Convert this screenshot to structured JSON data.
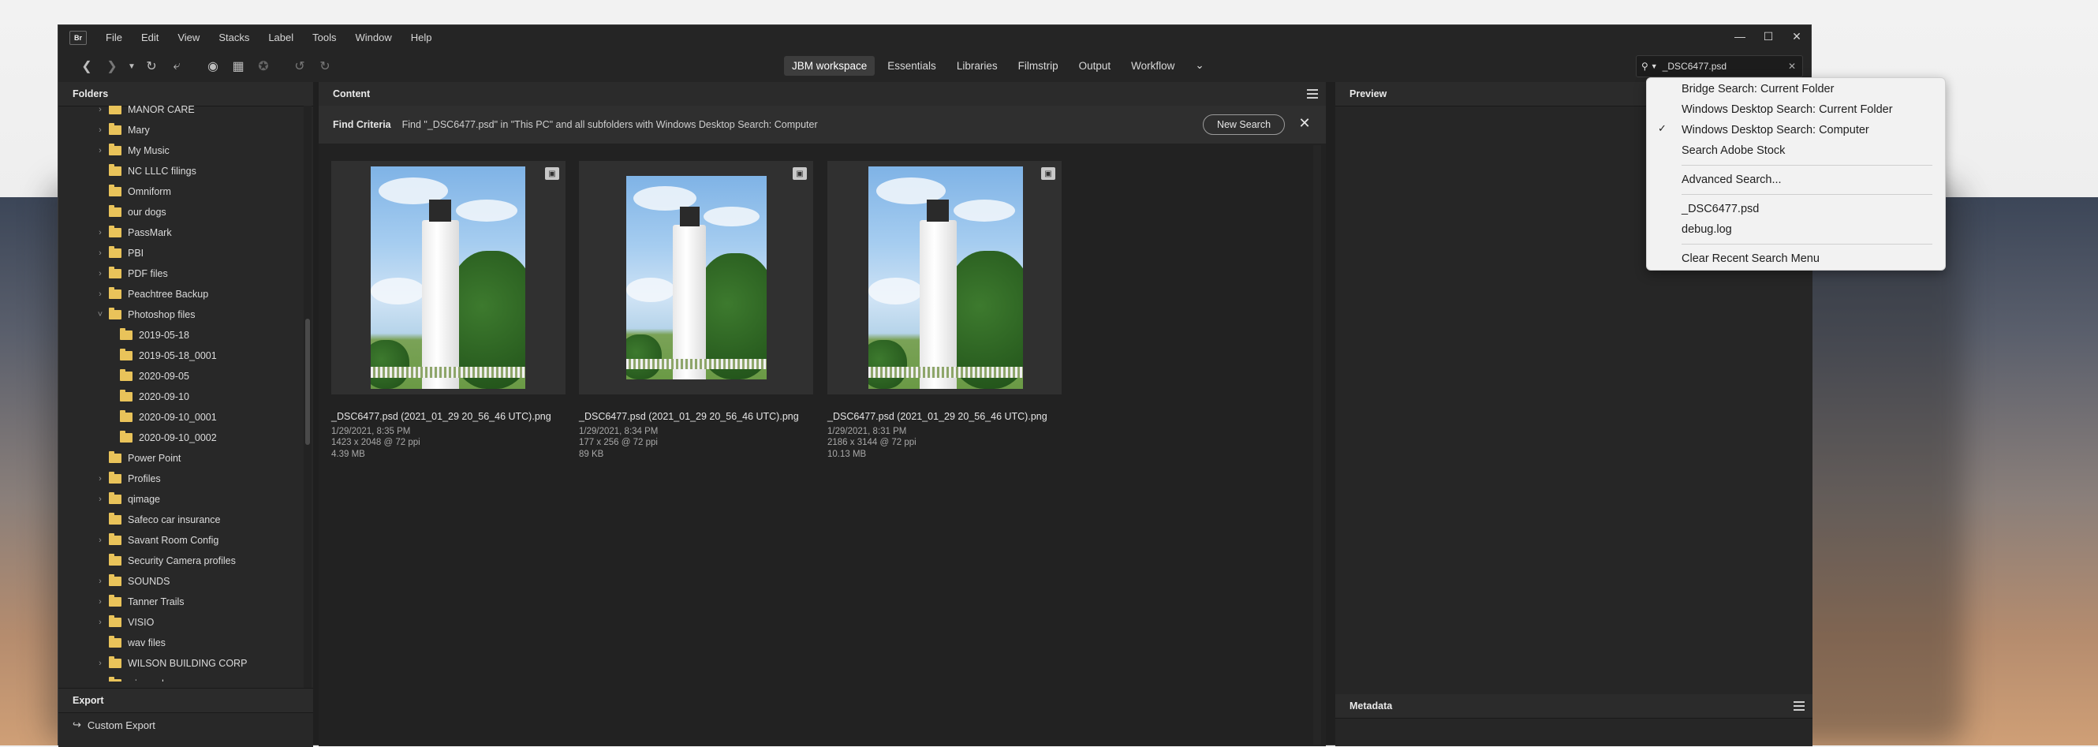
{
  "menubar": {
    "logo": "Br",
    "items": [
      "File",
      "Edit",
      "View",
      "Stacks",
      "Label",
      "Tools",
      "Window",
      "Help"
    ]
  },
  "workspaces": [
    "JBM workspace",
    "Essentials",
    "Libraries",
    "Filmstrip",
    "Output",
    "Workflow"
  ],
  "search": {
    "value": "_DSC6477.psd"
  },
  "panels": {
    "folders": "Folders",
    "content": "Content",
    "preview": "Preview",
    "metadata": "Metadata",
    "export": "Export"
  },
  "folders": [
    {
      "label": "MANOR CARE",
      "chevron": true,
      "indent": 0
    },
    {
      "label": "Mary",
      "chevron": true,
      "indent": 0
    },
    {
      "label": "My Music",
      "chevron": true,
      "indent": 0
    },
    {
      "label": "NC LLLC filings",
      "chevron": false,
      "indent": 0
    },
    {
      "label": "Omniform",
      "chevron": false,
      "indent": 0
    },
    {
      "label": "our dogs",
      "chevron": false,
      "indent": 0
    },
    {
      "label": "PassMark",
      "chevron": true,
      "indent": 0
    },
    {
      "label": "PBI",
      "chevron": true,
      "indent": 0
    },
    {
      "label": "PDF files",
      "chevron": true,
      "indent": 0
    },
    {
      "label": "Peachtree Backup",
      "chevron": true,
      "indent": 0
    },
    {
      "label": "Photoshop files",
      "chevron": true,
      "indent": 0,
      "expanded": true
    },
    {
      "label": "2019-05-18",
      "chevron": false,
      "indent": 1
    },
    {
      "label": "2019-05-18_0001",
      "chevron": false,
      "indent": 1
    },
    {
      "label": "2020-09-05",
      "chevron": false,
      "indent": 1
    },
    {
      "label": "2020-09-10",
      "chevron": false,
      "indent": 1
    },
    {
      "label": "2020-09-10_0001",
      "chevron": false,
      "indent": 1
    },
    {
      "label": "2020-09-10_0002",
      "chevron": false,
      "indent": 1
    },
    {
      "label": "Power Point",
      "chevron": false,
      "indent": 0
    },
    {
      "label": "Profiles",
      "chevron": true,
      "indent": 0
    },
    {
      "label": "qimage",
      "chevron": true,
      "indent": 0
    },
    {
      "label": "Safeco car insurance",
      "chevron": false,
      "indent": 0
    },
    {
      "label": "Savant Room Config",
      "chevron": true,
      "indent": 0
    },
    {
      "label": "Security Camera profiles",
      "chevron": false,
      "indent": 0
    },
    {
      "label": "SOUNDS",
      "chevron": true,
      "indent": 0
    },
    {
      "label": "Tanner Trails",
      "chevron": true,
      "indent": 0
    },
    {
      "label": "VISIO",
      "chevron": true,
      "indent": 0
    },
    {
      "label": "wav files",
      "chevron": false,
      "indent": 0
    },
    {
      "label": "WILSON BUILDING CORP",
      "chevron": true,
      "indent": 0
    },
    {
      "label": "winword",
      "chevron": true,
      "indent": 0
    }
  ],
  "export": {
    "custom_export": "Custom Export"
  },
  "find": {
    "label": "Find Criteria",
    "text": "Find \"_DSC6477.psd\" in \"This PC\" and all subfolders with Windows Desktop Search: Computer",
    "new_search": "New Search"
  },
  "thumbnails": [
    {
      "name": "_DSC6477.psd (2021_01_29 20_56_46 UTC).png",
      "date": "1/29/2021, 8:35 PM",
      "dims": "1423 x 2048 @ 72 ppi",
      "size": "4.39 MB"
    },
    {
      "name": "_DSC6477.psd (2021_01_29 20_56_46 UTC).png",
      "date": "1/29/2021, 8:34 PM",
      "dims": "177 x 256 @ 72 ppi",
      "size": "89 KB"
    },
    {
      "name": "_DSC6477.psd (2021_01_29 20_56_46 UTC).png",
      "date": "1/29/2021, 8:31 PM",
      "dims": "2186 x 3144 @ 72 ppi",
      "size": "10.13 MB"
    }
  ],
  "search_menu": {
    "items": [
      {
        "label": "Bridge Search: Current Folder",
        "checked": false
      },
      {
        "label": "Windows Desktop Search: Current Folder",
        "checked": false
      },
      {
        "label": "Windows Desktop Search: Computer",
        "checked": true
      },
      {
        "label": "Search Adobe Stock",
        "checked": false
      },
      {
        "label": "Advanced Search...",
        "checked": false
      },
      {
        "label": "_DSC6477.psd",
        "checked": false
      },
      {
        "label": "debug.log",
        "checked": false
      },
      {
        "label": "Clear Recent Search Menu",
        "checked": false
      }
    ]
  }
}
